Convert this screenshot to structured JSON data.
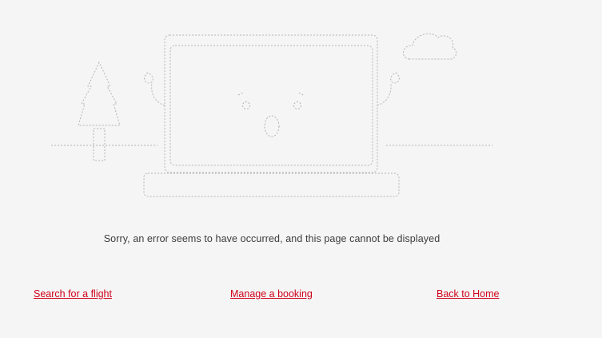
{
  "error": {
    "message": "Sorry, an error seems to have occurred, and this page cannot be displayed"
  },
  "illustration": {
    "name": "surprised-laptop-illustration",
    "stroke_color": "#b4b4b4"
  },
  "links": {
    "search_flight": "Search for a flight",
    "manage_booking": "Manage a booking",
    "back_home": "Back to Home"
  },
  "colors": {
    "background": "#f5f5f5",
    "link": "#d0021b",
    "text": "#3c3c3c"
  }
}
